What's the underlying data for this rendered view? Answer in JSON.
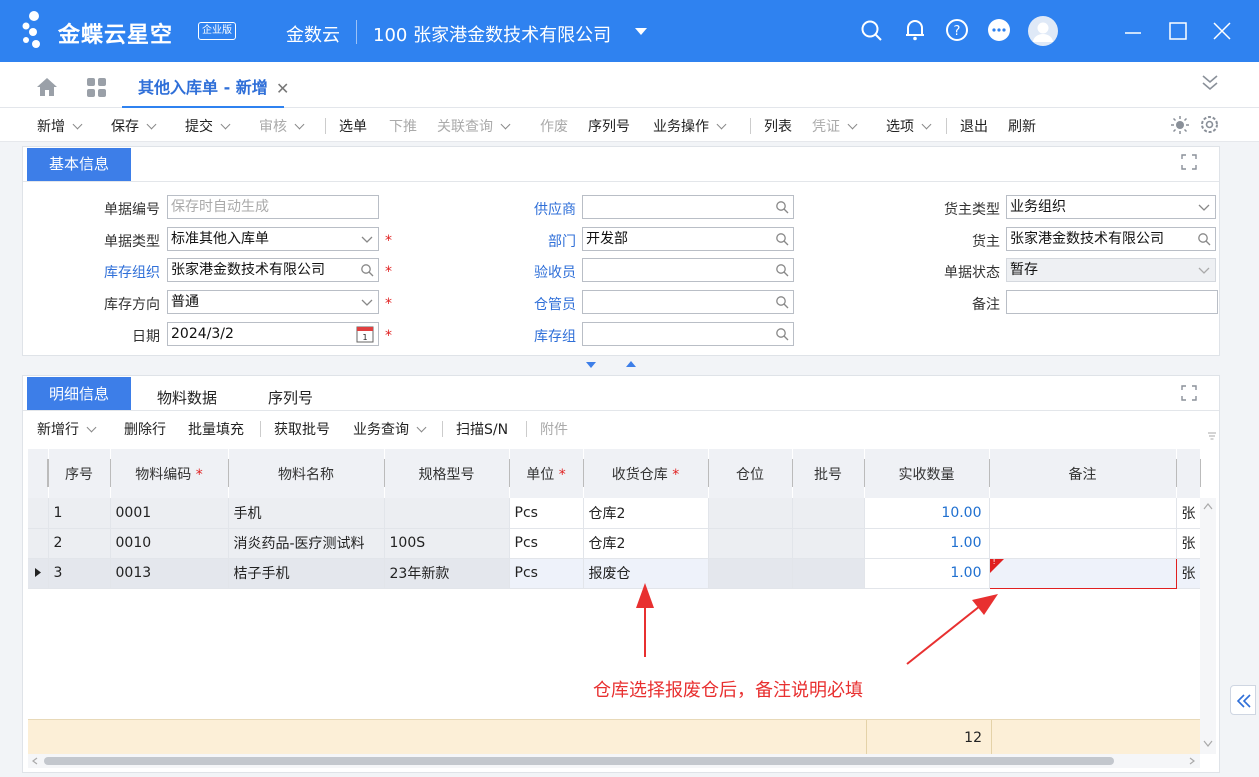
{
  "titlebar": {
    "logo_text": "金蝶云星空",
    "logo_badge": "企业版",
    "app_name": "金数云",
    "company": "100  张家港金数技术有限公司"
  },
  "tabs": {
    "active_label": "其他入库单 - 新增"
  },
  "toolbar": [
    {
      "label": "新增",
      "chev": true,
      "disabled": false
    },
    {
      "label": "保存",
      "chev": true,
      "disabled": false
    },
    {
      "label": "提交",
      "chev": true,
      "disabled": false
    },
    {
      "label": "审核",
      "chev": true,
      "disabled": true
    },
    {
      "label": "选单",
      "chev": false,
      "disabled": false
    },
    {
      "label": "下推",
      "chev": false,
      "disabled": true
    },
    {
      "label": "关联查询",
      "chev": true,
      "disabled": true
    },
    {
      "label": "作废",
      "chev": false,
      "disabled": true
    },
    {
      "label": "序列号",
      "chev": false,
      "disabled": false
    },
    {
      "label": "业务操作",
      "chev": true,
      "disabled": false
    },
    {
      "label": "列表",
      "chev": false,
      "disabled": false
    },
    {
      "label": "凭证",
      "chev": true,
      "disabled": true
    },
    {
      "label": "选项",
      "chev": true,
      "disabled": false
    },
    {
      "label": "退出",
      "chev": false,
      "disabled": false
    },
    {
      "label": "刷新",
      "chev": false,
      "disabled": false
    }
  ],
  "basic": {
    "tab_label": "基本信息",
    "doc_no_label": "单据编号",
    "doc_no_placeholder": "保存时自动生成",
    "doc_type_label": "单据类型",
    "doc_type_value": "标准其他入库单",
    "stock_org_label": "库存组织",
    "stock_org_value": "张家港金数技术有限公司",
    "stock_dir_label": "库存方向",
    "stock_dir_value": "普通",
    "date_label": "日期",
    "date_value": "2024/3/2",
    "supplier_label": "供应商",
    "supplier_value": "",
    "dept_label": "部门",
    "dept_value": "开发部",
    "inspector_label": "验收员",
    "inspector_value": "",
    "keeper_label": "仓管员",
    "keeper_value": "",
    "stock_group_label": "库存组",
    "stock_group_value": "",
    "owner_type_label": "货主类型",
    "owner_type_value": "业务组织",
    "owner_label": "货主",
    "owner_value": "张家港金数技术有限公司",
    "status_label": "单据状态",
    "status_value": "暂存",
    "remark_label": "备注",
    "remark_value": "",
    "required_mark": "*"
  },
  "detail": {
    "tabs": [
      "明细信息",
      "物料数据",
      "序列号"
    ],
    "toolbar": [
      {
        "label": "新增行",
        "chev": true,
        "disabled": false
      },
      {
        "label": "删除行",
        "chev": false,
        "disabled": false
      },
      {
        "label": "批量填充",
        "chev": false,
        "disabled": false
      },
      {
        "label": "获取批号",
        "chev": false,
        "disabled": false
      },
      {
        "label": "业务查询",
        "chev": true,
        "disabled": false
      },
      {
        "label": "扫描S/N",
        "chev": false,
        "disabled": false
      },
      {
        "label": "附件",
        "chev": false,
        "disabled": true
      }
    ],
    "columns": [
      "序号",
      "物料编码",
      "物料名称",
      "规格型号",
      "单位",
      "收货仓库",
      "仓位",
      "批号",
      "实收数量",
      "备注"
    ],
    "required_cols": [
      "物料编码",
      "单位",
      "收货仓库"
    ],
    "rows": [
      {
        "seq": "1",
        "code": "0001",
        "name": "手机",
        "spec": "",
        "unit": "Pcs",
        "warehouse": "仓库2",
        "loc": "",
        "lot": "",
        "qty": "10.00",
        "remark": "",
        "extra": "张"
      },
      {
        "seq": "2",
        "code": "0010",
        "name": "消炎药品-医疗测试料",
        "spec": "100S",
        "unit": "Pcs",
        "warehouse": "仓库2",
        "loc": "",
        "lot": "",
        "qty": "1.00",
        "remark": "",
        "extra": "张"
      },
      {
        "seq": "3",
        "code": "0013",
        "name": "桔子手机",
        "spec": "23年新款",
        "unit": "Pcs",
        "warehouse": "报废仓",
        "loc": "",
        "lot": "",
        "qty": "1.00",
        "remark": "",
        "extra": "张"
      }
    ],
    "total_qty": "12",
    "error_marker": "!"
  },
  "annotation": "仓库选择报废仓后，备注说明必填",
  "colors": {
    "brand": "#2f82f0",
    "tab_active": "#3d7ee8",
    "error": "#e02020",
    "link": "#2f6fd8"
  }
}
